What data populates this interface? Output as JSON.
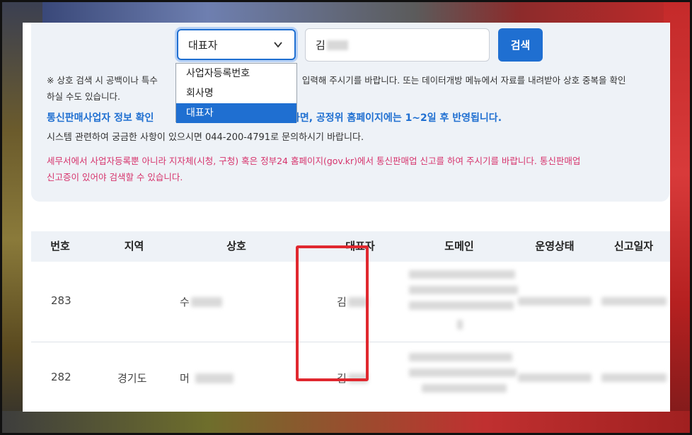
{
  "search": {
    "select_value": "대표자",
    "query_value": "김",
    "button_label": "검색",
    "options": [
      "사업자등록번호",
      "회사명",
      "대표자"
    ],
    "selected_option": "대표자"
  },
  "notes": {
    "line1_part1": "※ 상호 검색 시 공백이나 특수",
    "line1_part2": "입력해 주시기를 바랍니다. 또는 데이터개방 메뉴에서 자료를 내려받아 상호 중복을 확인",
    "line1_part3": "하실 수도 있습니다.",
    "blue_part1": "통신판매사업자 정보 확인",
    "blue_part2": "등록하면, 공정위 홈페이지에는 1~2일 후 반영됩니다.",
    "phone": "시스템 관련하여 궁금한 사항이 있으시면 044-200-4791로 문의하시기 바랍니다.",
    "red_line1": "세무서에서 사업자등록뿐 아니라 지자체(시청, 구청) 혹은 정부24 홈페이지(gov.kr)에서 통신판매업 신고를 하여 주시기를 바랍니다. 통신판매업",
    "red_line2": "신고증이 있어야 검색할 수 있습니다."
  },
  "table": {
    "headers": [
      "번호",
      "지역",
      "상호",
      "대표자",
      "도메인",
      "운영상태",
      "신고일자"
    ],
    "rows": [
      {
        "num": "283",
        "region": "",
        "name": "수",
        "rep": "김"
      },
      {
        "num": "282",
        "region": "경기도",
        "name": "머",
        "rep": "김"
      }
    ]
  },
  "colors": {
    "accent": "#1f6fd1",
    "highlight": "#e0282f",
    "warning_text": "#d6336c"
  },
  "icons": {
    "select_chevron": "chevron-down-icon"
  }
}
